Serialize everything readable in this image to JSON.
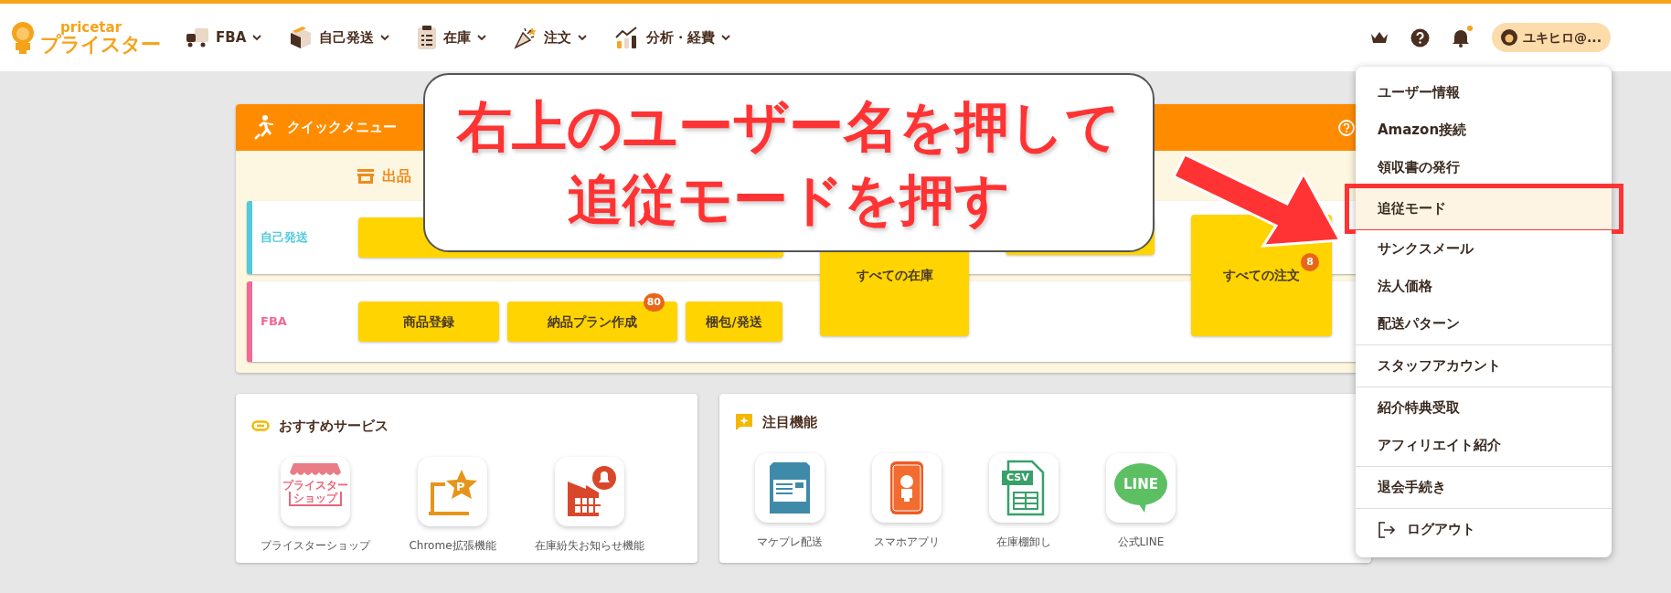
{
  "logo": {
    "top": "pricetar",
    "main": "プライスター"
  },
  "nav": [
    {
      "label": "FBA",
      "kind": "truck"
    },
    {
      "label": "自己発送",
      "kind": "box"
    },
    {
      "label": "在庫",
      "kind": "clipboard"
    },
    {
      "label": "注文",
      "kind": "party"
    },
    {
      "label": "分析・経費",
      "kind": "chart"
    }
  ],
  "header_right": {
    "notification_dot": true,
    "user": "ユキヒロ@..."
  },
  "quick_menu": {
    "title": "クイックメニュー",
    "section": "出品",
    "rows": [
      {
        "label": "自己発送",
        "color": "#4fcbdc",
        "buttons": [
          {
            "kind": "wide"
          }
        ]
      },
      {
        "label": "FBA",
        "color": "#ef6a95",
        "buttons": [
          {
            "label": "商品登録",
            "kind": "normal"
          },
          {
            "label": "納品プラン作成",
            "badge": "80",
            "kind": "normal"
          },
          {
            "label": "梱包/発送",
            "kind": "normal"
          }
        ]
      }
    ],
    "tall_buttons": [
      {
        "label": "すべての在庫",
        "kind": "tall"
      },
      {
        "kind": "short"
      },
      {
        "label": "すべての注文",
        "badge": "8",
        "kind": "tall"
      }
    ]
  },
  "recommended": {
    "title": "おすすめサービス",
    "items": [
      {
        "label": "プライスターショップ",
        "kind": "shop",
        "icon_text": [
          "プライスター",
          "ショップ"
        ]
      },
      {
        "label": "Chrome拡張機能",
        "kind": "extension",
        "icon_text": [
          "P"
        ]
      },
      {
        "label": "在庫紛失お知らせ機能",
        "kind": "alert"
      }
    ]
  },
  "featured": {
    "title": "注目機能",
    "items": [
      {
        "label": "マケプレ配送",
        "kind": "mailbox"
      },
      {
        "label": "スマホアプリ",
        "kind": "phone"
      },
      {
        "label": "在庫棚卸し",
        "kind": "csv",
        "icon_text": [
          "CSV"
        ]
      },
      {
        "label": "公式LINE",
        "kind": "line",
        "icon_text": [
          "LINE"
        ]
      }
    ]
  },
  "user_menu": {
    "groups": [
      [
        {
          "label": "ユーザー情報",
          "selected": false
        },
        {
          "label": "Amazon接続",
          "selected": false
        },
        {
          "label": "領収書の発行",
          "selected": false
        },
        {
          "label": "追従モード",
          "selected": true
        },
        {
          "label": "サンクスメール",
          "selected": false
        },
        {
          "label": "法人価格",
          "selected": false
        },
        {
          "label": "配送パターン",
          "selected": false
        }
      ],
      [
        {
          "label": "スタッフアカウント",
          "selected": false
        }
      ],
      [
        {
          "label": "紹介特典受取",
          "selected": false
        },
        {
          "label": "アフィリエイト紹介",
          "selected": false
        }
      ],
      [
        {
          "label": "退会手続き",
          "selected": false
        }
      ],
      [
        {
          "label": "ログアウト",
          "selected": false,
          "kind": "logout"
        }
      ]
    ]
  },
  "annotation": {
    "lines": [
      "右上のユーザー名を押して",
      "追従モードを押す"
    ]
  }
}
